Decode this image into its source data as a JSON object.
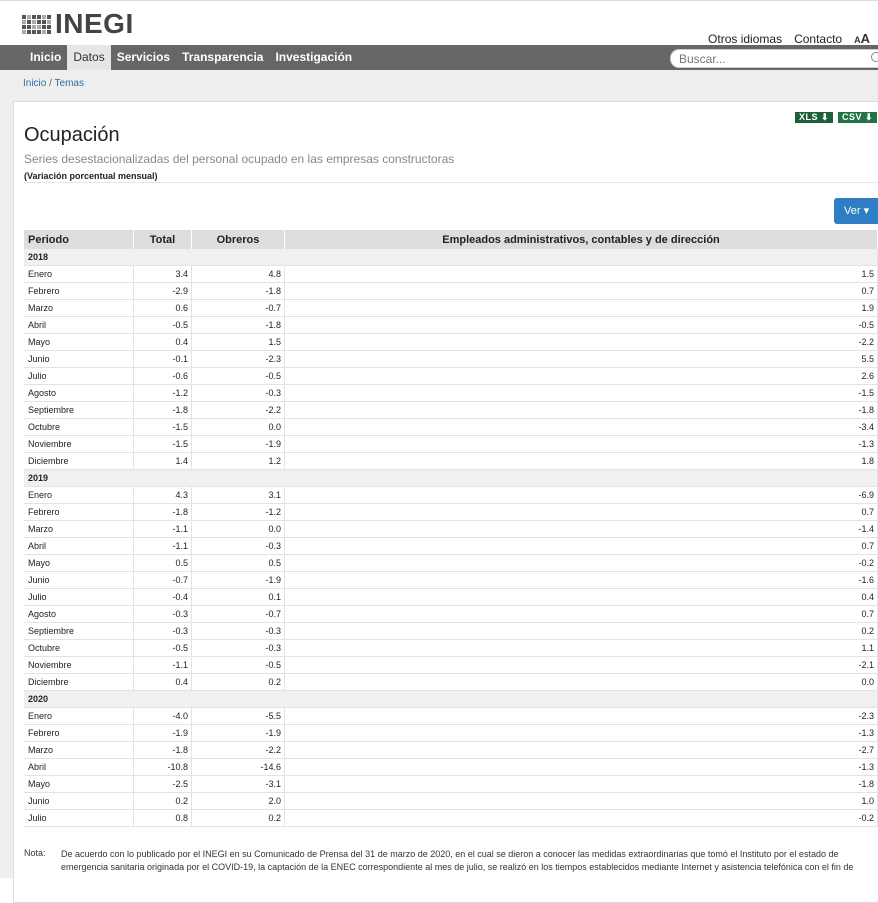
{
  "header": {
    "logo_text": "INEGI",
    "links": [
      "Otros idiomas",
      "Contacto"
    ],
    "font_size_big": "A",
    "font_size_small": "A"
  },
  "nav": {
    "items": [
      "Inicio",
      "Datos",
      "Servicios",
      "Transparencia",
      "Investigación"
    ],
    "active": "Datos",
    "search_placeholder": "Buscar..."
  },
  "breadcrumb": {
    "home": "Inicio",
    "sep": "/",
    "current": "Temas"
  },
  "downloads": {
    "xls": "XLS ⬇",
    "csv": "CSV ⬇"
  },
  "page": {
    "title": "Ocupación",
    "subtitle": "Series desestacionalizadas del personal ocupado en las empresas constructoras",
    "unit": "(Variación porcentual mensual)",
    "ver_button": "Ver ▾"
  },
  "table": {
    "headers": [
      "Periodo",
      "Total",
      "Obreros",
      "Empleados administrativos, contables y de dirección"
    ],
    "groups": [
      {
        "year": "2018",
        "rows": [
          [
            "Enero",
            "3.4",
            "4.8",
            "1.5"
          ],
          [
            "Febrero",
            "-2.9",
            "-1.8",
            "0.7"
          ],
          [
            "Marzo",
            "0.6",
            "-0.7",
            "1.9"
          ],
          [
            "Abril",
            "-0.5",
            "-1.8",
            "-0.5"
          ],
          [
            "Mayo",
            "0.4",
            "1.5",
            "-2.2"
          ],
          [
            "Junio",
            "-0.1",
            "-2.3",
            "5.5"
          ],
          [
            "Julio",
            "-0.6",
            "-0.5",
            "2.6"
          ],
          [
            "Agosto",
            "-1.2",
            "-0.3",
            "-1.5"
          ],
          [
            "Septiembre",
            "-1.8",
            "-2.2",
            "-1.8"
          ],
          [
            "Octubre",
            "-1.5",
            "0.0",
            "-3.4"
          ],
          [
            "Noviembre",
            "-1.5",
            "-1.9",
            "-1.3"
          ],
          [
            "Diciembre",
            "1.4",
            "1.2",
            "1.8"
          ]
        ]
      },
      {
        "year": "2019",
        "rows": [
          [
            "Enero",
            "4.3",
            "3.1",
            "-6.9"
          ],
          [
            "Febrero",
            "-1.8",
            "-1.2",
            "0.7"
          ],
          [
            "Marzo",
            "-1.1",
            "0.0",
            "-1.4"
          ],
          [
            "Abril",
            "-1.1",
            "-0.3",
            "0.7"
          ],
          [
            "Mayo",
            "0.5",
            "0.5",
            "-0.2"
          ],
          [
            "Junio",
            "-0.7",
            "-1.9",
            "-1.6"
          ],
          [
            "Julio",
            "-0.4",
            "0.1",
            "0.4"
          ],
          [
            "Agosto",
            "-0.3",
            "-0.7",
            "0.7"
          ],
          [
            "Septiembre",
            "-0.3",
            "-0.3",
            "0.2"
          ],
          [
            "Octubre",
            "-0.5",
            "-0.3",
            "1.1"
          ],
          [
            "Noviembre",
            "-1.1",
            "-0.5",
            "-2.1"
          ],
          [
            "Diciembre",
            "0.4",
            "0.2",
            "0.0"
          ]
        ]
      },
      {
        "year": "2020",
        "rows": [
          [
            "Enero",
            "-4.0",
            "-5.5",
            "-2.3"
          ],
          [
            "Febrero",
            "-1.9",
            "-1.9",
            "-1.3"
          ],
          [
            "Marzo",
            "-1.8",
            "-2.2",
            "-2.7"
          ],
          [
            "Abril",
            "-10.8",
            "-14.6",
            "-1.3"
          ],
          [
            "Mayo",
            "-2.5",
            "-3.1",
            "-1.8"
          ],
          [
            "Junio",
            "0.2",
            "2.0",
            "1.0"
          ],
          [
            "Julio",
            "0.8",
            "0.2",
            "-0.2"
          ]
        ]
      }
    ]
  },
  "note": {
    "label": "Nota:",
    "text": "De acuerdo con lo publicado por el INEGI en su Comunicado de Prensa del 31 de marzo de 2020, en el cual se dieron a conocer las medidas extraordinarias que tomó el Instituto por el estado de emergencia sanitaria originada por el COVID-19, la captación de la ENEC correspondiente al mes de julio, se realizó en los tiempos establecidos mediante Internet y asistencia telefónica con el fin de"
  }
}
